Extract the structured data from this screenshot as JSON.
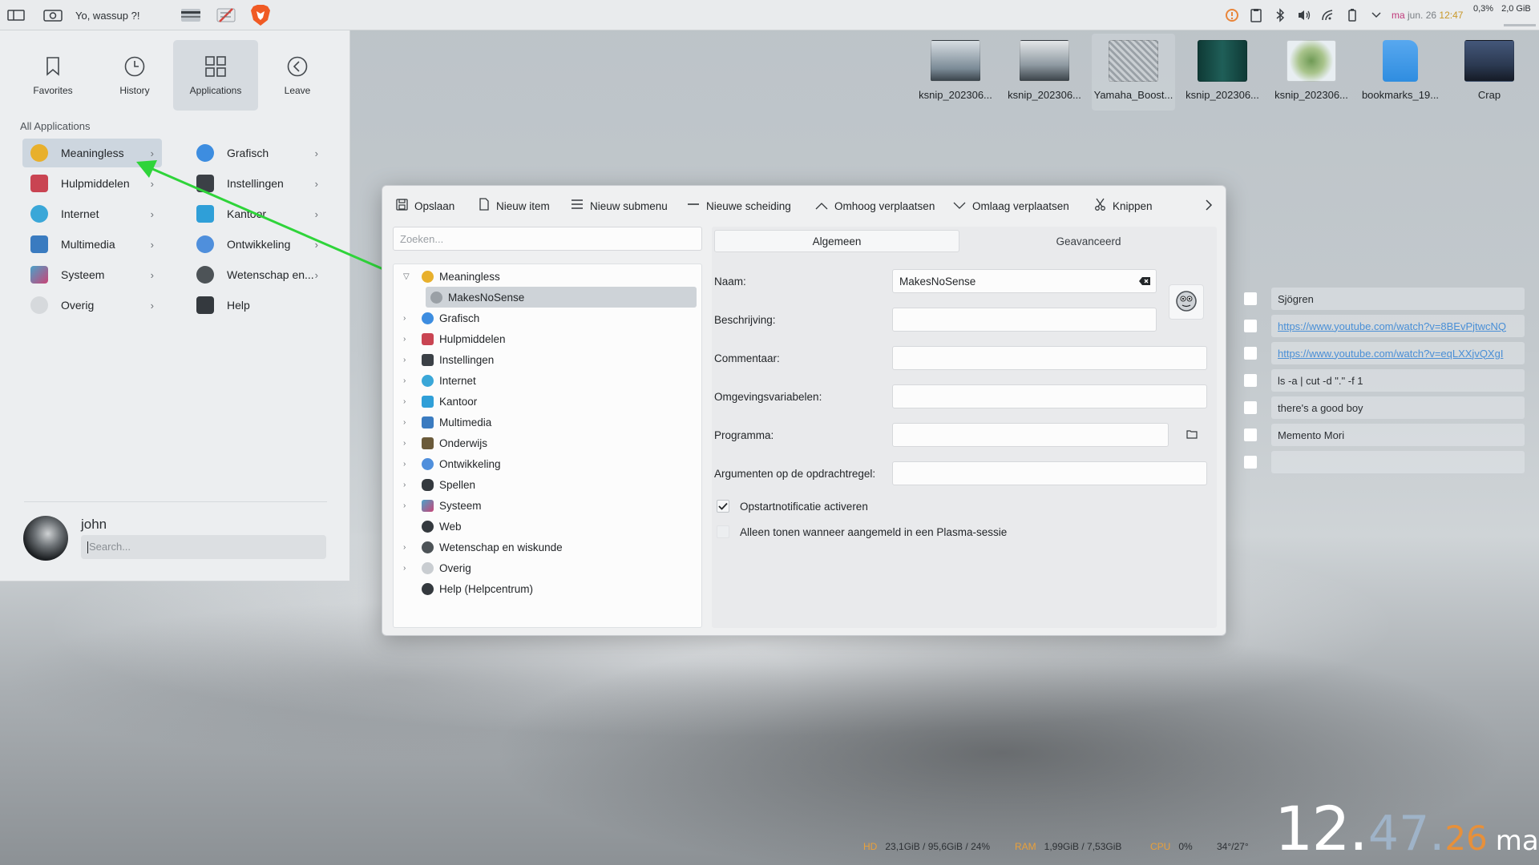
{
  "topbar": {
    "greeting": "Yo, wassup ?!",
    "sys_load": "0,3%",
    "sys_mem": "2,0 GiB",
    "date_day": "ma",
    "date": "jun. 26",
    "time": "12:47"
  },
  "launcher": {
    "tabs": [
      {
        "label": "Favorites",
        "icon": "bookmark-icon"
      },
      {
        "label": "History",
        "icon": "clock-icon"
      },
      {
        "label": "Applications",
        "icon": "grid-icon"
      },
      {
        "label": "Leave",
        "icon": "back-icon"
      }
    ],
    "section_title": "All Applications",
    "categories_left": [
      {
        "label": "Meaningless",
        "color": "#e8b02c"
      },
      {
        "label": "Hulpmiddelen",
        "color": "#c94452"
      },
      {
        "label": "Internet",
        "color": "#3aa7d8"
      },
      {
        "label": "Multimedia",
        "color": "#3a7bc0"
      },
      {
        "label": "Systeem",
        "color": "#4aa2c9"
      },
      {
        "label": "Overig",
        "color": "#9aa0a6"
      }
    ],
    "categories_right": [
      {
        "label": "Grafisch",
        "color": "#3d8de0"
      },
      {
        "label": "Instellingen",
        "color": "#3b4046"
      },
      {
        "label": "Kantoor",
        "color": "#2f9fd8"
      },
      {
        "label": "Ontwikkeling",
        "color": "#4f8fdc"
      },
      {
        "label": "Wetenschap en...",
        "color": "#4d5357"
      },
      {
        "label": "Help",
        "color": "#34393e"
      }
    ],
    "user_name": "john",
    "search_placeholder": "Search..."
  },
  "desktop_icons": [
    {
      "label": "ksnip_202306...",
      "color": "#7a8a96"
    },
    {
      "label": "ksnip_202306...",
      "color": "#8f9aa2"
    },
    {
      "label": "Yamaha_Boost...",
      "color": "#b3b8bc"
    },
    {
      "label": "ksnip_202306...",
      "color": "#1f5f58"
    },
    {
      "label": "ksnip_202306...",
      "color": "#cfd7cf"
    },
    {
      "label": "bookmarks_19...",
      "color": "#2f8de0"
    },
    {
      "label": "Crap",
      "color": "#2c3a52"
    }
  ],
  "editor": {
    "toolbar": {
      "save": "Opslaan",
      "new_item": "Nieuw item",
      "new_submenu": "Nieuw submenu",
      "new_separator": "Nieuwe scheiding",
      "move_up": "Omhoog verplaatsen",
      "move_down": "Omlaag verplaatsen",
      "cut": "Knippen"
    },
    "search_placeholder": "Zoeken...",
    "tree": [
      {
        "label": "Meaningless",
        "level": 0,
        "expanded": true,
        "color": "#e8b02c"
      },
      {
        "label": "MakesNoSense",
        "level": 1,
        "selected": true,
        "color": "#9aa0a6"
      },
      {
        "label": "Grafisch",
        "level": 0,
        "color": "#3d8de0"
      },
      {
        "label": "Hulpmiddelen",
        "level": 0,
        "color": "#c94452"
      },
      {
        "label": "Instellingen",
        "level": 0,
        "color": "#3b4046"
      },
      {
        "label": "Internet",
        "level": 0,
        "color": "#3aa7d8"
      },
      {
        "label": "Kantoor",
        "level": 0,
        "color": "#2f9fd8"
      },
      {
        "label": "Multimedia",
        "level": 0,
        "color": "#3a7bc0"
      },
      {
        "label": "Onderwijs",
        "level": 0,
        "color": "#6a5a3a"
      },
      {
        "label": "Ontwikkeling",
        "level": 0,
        "color": "#4f8fdc"
      },
      {
        "label": "Spellen",
        "level": 0,
        "color": "#34393e"
      },
      {
        "label": "Systeem",
        "level": 0,
        "color": "#4aa2c9"
      },
      {
        "label": "Web",
        "level": 0,
        "color": "#34393e"
      },
      {
        "label": "Wetenschap en wiskunde",
        "level": 0,
        "color": "#4d5357"
      },
      {
        "label": "Overig",
        "level": 0,
        "color": "#9aa0a6"
      },
      {
        "label": "Help (Helpcentrum)",
        "level": 0,
        "color": "#34393e",
        "leaf": true
      }
    ],
    "tabs": {
      "general": "Algemeen",
      "advanced": "Geavanceerd"
    },
    "form": {
      "name_label": "Naam:",
      "name_value": "MakesNoSense",
      "description_label": "Beschrijving:",
      "comment_label": "Commentaar:",
      "env_label": "Omgevingsvariabelen:",
      "program_label": "Programma:",
      "args_label": "Argumenten op de opdrachtregel:",
      "startup_notify_label": "Opstartnotificatie activeren",
      "plasma_only_label": "Alleen tonen wanneer aangemeld in een Plasma-sessie"
    }
  },
  "notes": [
    {
      "text": "Sjögren",
      "link": false
    },
    {
      "text": "https://www.youtube.com/watch?v=8BEvPjtwcNQ",
      "link": true
    },
    {
      "text": "https://www.youtube.com/watch?v=eqLXXjvQXgI",
      "link": true
    },
    {
      "text": "ls -a | cut -d \".\" -f 1",
      "link": false
    },
    {
      "text": "there's a good boy",
      "link": false
    },
    {
      "text": "Memento Mori",
      "link": false
    },
    {
      "text": "",
      "link": false
    }
  ],
  "stats": {
    "hd_label": "HD",
    "hd_value": "23,1GiB / 95,6GiB / 24%",
    "ram_label": "RAM",
    "ram_value": "1,99GiB / 7,53GiB",
    "cpu_label": "CPU",
    "cpu_value": "0%",
    "temp_value": "34°/27°"
  },
  "clock": {
    "hours": "12",
    "minutes": "47",
    "seconds": "26",
    "day": "ma"
  }
}
